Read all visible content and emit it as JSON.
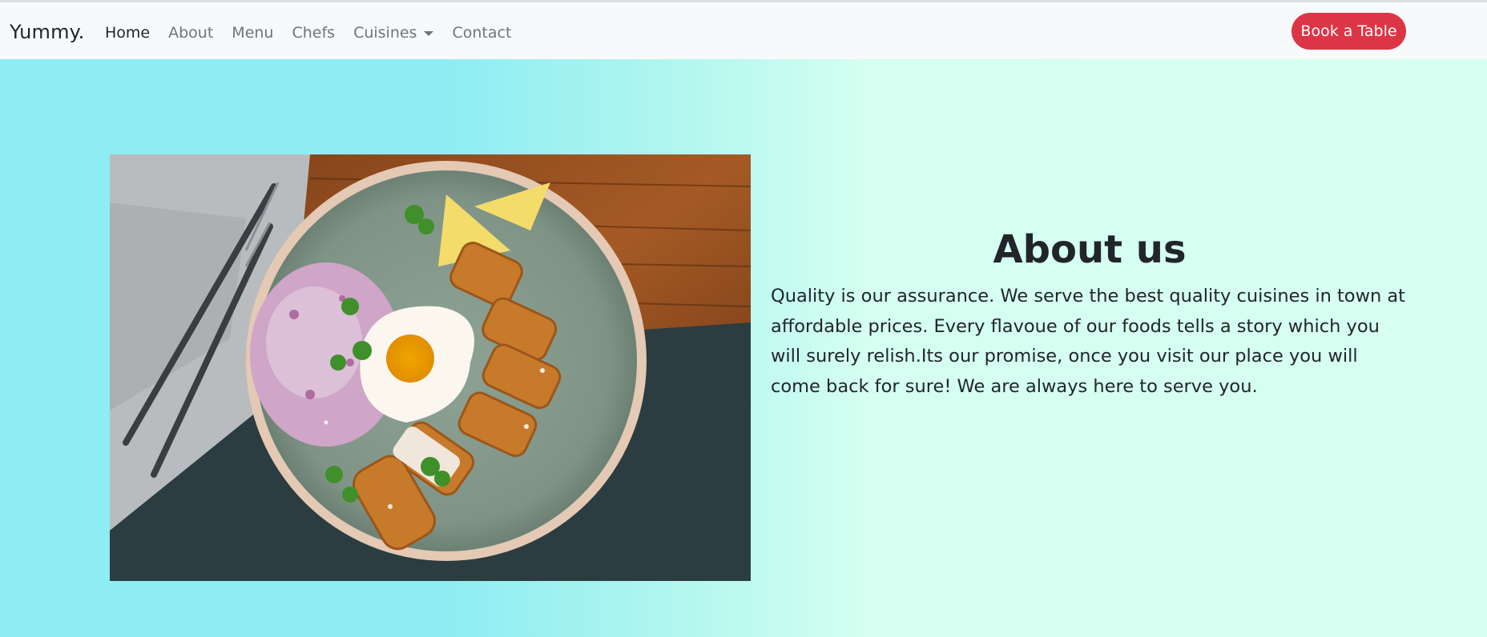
{
  "nav": {
    "brand": "Yummy.",
    "links": [
      {
        "label": "Home"
      },
      {
        "label": "About"
      },
      {
        "label": "Menu"
      },
      {
        "label": "Chefs"
      },
      {
        "label": "Cuisines"
      },
      {
        "label": "Contact"
      }
    ],
    "cta_label": "Book a Table"
  },
  "about": {
    "title": "About us",
    "text": "Quality is our assurance. We serve the best quality cuisines in town at affordable prices. Every flavoue of our foods tells a story which you will surely relish.Its our promise, once you visit our place you will come back for sure! We are always here to serve you."
  },
  "colors": {
    "cta": "#dc3545",
    "hero_left": "#8eedf2",
    "hero_right": "#d6fff1",
    "nav_bg": "#f8f9fa"
  },
  "icons": [
    "dropdown-caret-icon"
  ]
}
